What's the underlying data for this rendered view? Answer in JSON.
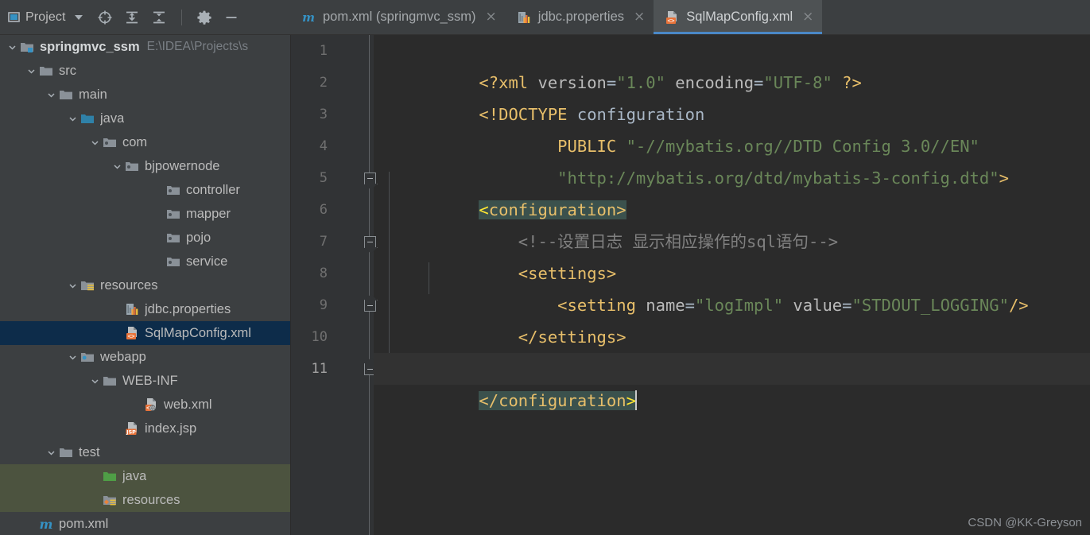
{
  "window": {
    "toolbar": {
      "panel_title": "Project",
      "dropdown_icon": "chevron-down-icon",
      "icons": [
        {
          "name": "locate-target-icon",
          "label": "Select Opened File"
        },
        {
          "name": "expand-all-icon",
          "label": "Expand All"
        },
        {
          "name": "collapse-all-icon",
          "label": "Collapse All"
        },
        {
          "name": "gear-icon",
          "label": "Settings"
        },
        {
          "name": "minimize-icon",
          "label": "Hide"
        }
      ]
    }
  },
  "tabs": [
    {
      "label": "pom.xml (springmvc_ssm)",
      "icon": "maven-m-icon",
      "active": false,
      "close": "×"
    },
    {
      "label": "jdbc.properties",
      "icon": "properties-icon",
      "active": false,
      "close": "×"
    },
    {
      "label": "SqlMapConfig.xml",
      "icon": "xml-file-icon",
      "active": true,
      "close": "×"
    }
  ],
  "project_tree": [
    {
      "label": "springmvc_ssm",
      "path": "E:\\IDEA\\Projects\\s",
      "icon": "module-folder-icon",
      "indent": 0,
      "twist": "expanded",
      "bold": true,
      "state": "normal"
    },
    {
      "label": "src",
      "icon": "folder-icon",
      "indent": 1,
      "twist": "expanded",
      "bold": false,
      "state": "normal"
    },
    {
      "label": "main",
      "icon": "folder-icon",
      "indent": 2,
      "twist": "expanded",
      "bold": false,
      "state": "normal"
    },
    {
      "label": "java",
      "icon": "source-root-folder-icon",
      "indent": 3,
      "twist": "expanded",
      "bold": false,
      "state": "normal"
    },
    {
      "label": "com",
      "icon": "package-icon",
      "indent": 4,
      "twist": "expanded",
      "bold": false,
      "state": "normal"
    },
    {
      "label": "bjpowernode",
      "icon": "package-icon",
      "indent": 5,
      "twist": "expanded",
      "bold": false,
      "state": "normal"
    },
    {
      "label": "controller",
      "icon": "package-icon",
      "indent": 6,
      "twist": "none",
      "bold": false,
      "state": "normal"
    },
    {
      "label": "mapper",
      "icon": "package-icon",
      "indent": 6,
      "twist": "none",
      "bold": false,
      "state": "normal"
    },
    {
      "label": "pojo",
      "icon": "package-icon",
      "indent": 6,
      "twist": "none",
      "bold": false,
      "state": "normal"
    },
    {
      "label": "service",
      "icon": "package-icon",
      "indent": 6,
      "twist": "none",
      "bold": false,
      "state": "normal"
    },
    {
      "label": "resources",
      "icon": "resource-root-folder-icon",
      "indent": 3,
      "twist": "expanded",
      "bold": false,
      "state": "normal"
    },
    {
      "label": "jdbc.properties",
      "icon": "properties-icon",
      "indent": 4,
      "twist": "none",
      "bold": false,
      "state": "normal"
    },
    {
      "label": "SqlMapConfig.xml",
      "icon": "xml-file-icon",
      "indent": 4,
      "twist": "none",
      "bold": false,
      "state": "selected"
    },
    {
      "label": "webapp",
      "icon": "web-folder-icon",
      "indent": 3,
      "twist": "expanded",
      "bold": false,
      "state": "normal"
    },
    {
      "label": "WEB-INF",
      "icon": "folder-icon",
      "indent": 4,
      "twist": "expanded",
      "bold": false,
      "state": "normal"
    },
    {
      "label": "web.xml",
      "icon": "web-xml-icon",
      "indent": 5,
      "twist": "none",
      "bold": false,
      "state": "normal"
    },
    {
      "label": "index.jsp",
      "icon": "jsp-file-icon",
      "indent": 4,
      "twist": "none",
      "bold": false,
      "state": "normal"
    },
    {
      "label": "test",
      "icon": "folder-icon",
      "indent": 2,
      "twist": "expanded",
      "bold": false,
      "state": "normal"
    },
    {
      "label": "java",
      "icon": "test-source-root-folder-icon",
      "indent": 3,
      "twist": "none",
      "bold": false,
      "state": "green"
    },
    {
      "label": "resources",
      "icon": "test-resource-root-folder-icon",
      "indent": 3,
      "twist": "none",
      "bold": false,
      "state": "green"
    },
    {
      "label": "pom.xml",
      "icon": "maven-m-icon",
      "indent": 1,
      "twist": "none",
      "bold": false,
      "state": "normal"
    }
  ],
  "editor": {
    "file": "SqlMapConfig.xml",
    "current_line": 11,
    "line_numbers": [
      1,
      2,
      3,
      4,
      5,
      6,
      7,
      8,
      9,
      10,
      11
    ],
    "lines": [
      {
        "n": 1,
        "text": "<?xml version=\"1.0\" encoding=\"UTF-8\" ?>"
      },
      {
        "n": 2,
        "text": "<!DOCTYPE configuration"
      },
      {
        "n": 3,
        "text": "        PUBLIC \"-//mybatis.org//DTD Config 3.0//EN\""
      },
      {
        "n": 4,
        "text": "        \"http://mybatis.org/dtd/mybatis-3-config.dtd\">"
      },
      {
        "n": 5,
        "text": "<configuration>"
      },
      {
        "n": 6,
        "text": "    <!--设置日志 显示相应操作的sql语句-->"
      },
      {
        "n": 7,
        "text": "    <settings>"
      },
      {
        "n": 8,
        "text": "        <setting name=\"logImpl\" value=\"STDOUT_LOGGING\"/>"
      },
      {
        "n": 9,
        "text": "    </settings>"
      },
      {
        "n": 10,
        "text": ""
      },
      {
        "n": 11,
        "text": "</configuration>"
      }
    ],
    "gutter_markers": [
      {
        "line": 5,
        "type": "fold-start"
      },
      {
        "line": 7,
        "type": "fold-start"
      },
      {
        "line": 9,
        "type": "fold-end"
      },
      {
        "line": 10,
        "type": "intention-bulb-icon"
      },
      {
        "line": 11,
        "type": "fold-end"
      }
    ]
  },
  "watermark": "CSDN @KK-Greyson",
  "colors": {
    "editor_bg": "#2b2b2b",
    "panel_bg": "#3c3f41",
    "gutter_bg": "#313335",
    "tab_active_bg": "#4e5254",
    "tab_active_underline": "#4a88c7",
    "tree_selected_bg": "#0d2c4a",
    "tree_green_bg": "#4c533f",
    "brace_match_bg": "#3b514d",
    "tag_color": "#e8bf6a",
    "string_color": "#6a8759",
    "attr_color": "#bababa",
    "comment_color": "#808080"
  }
}
